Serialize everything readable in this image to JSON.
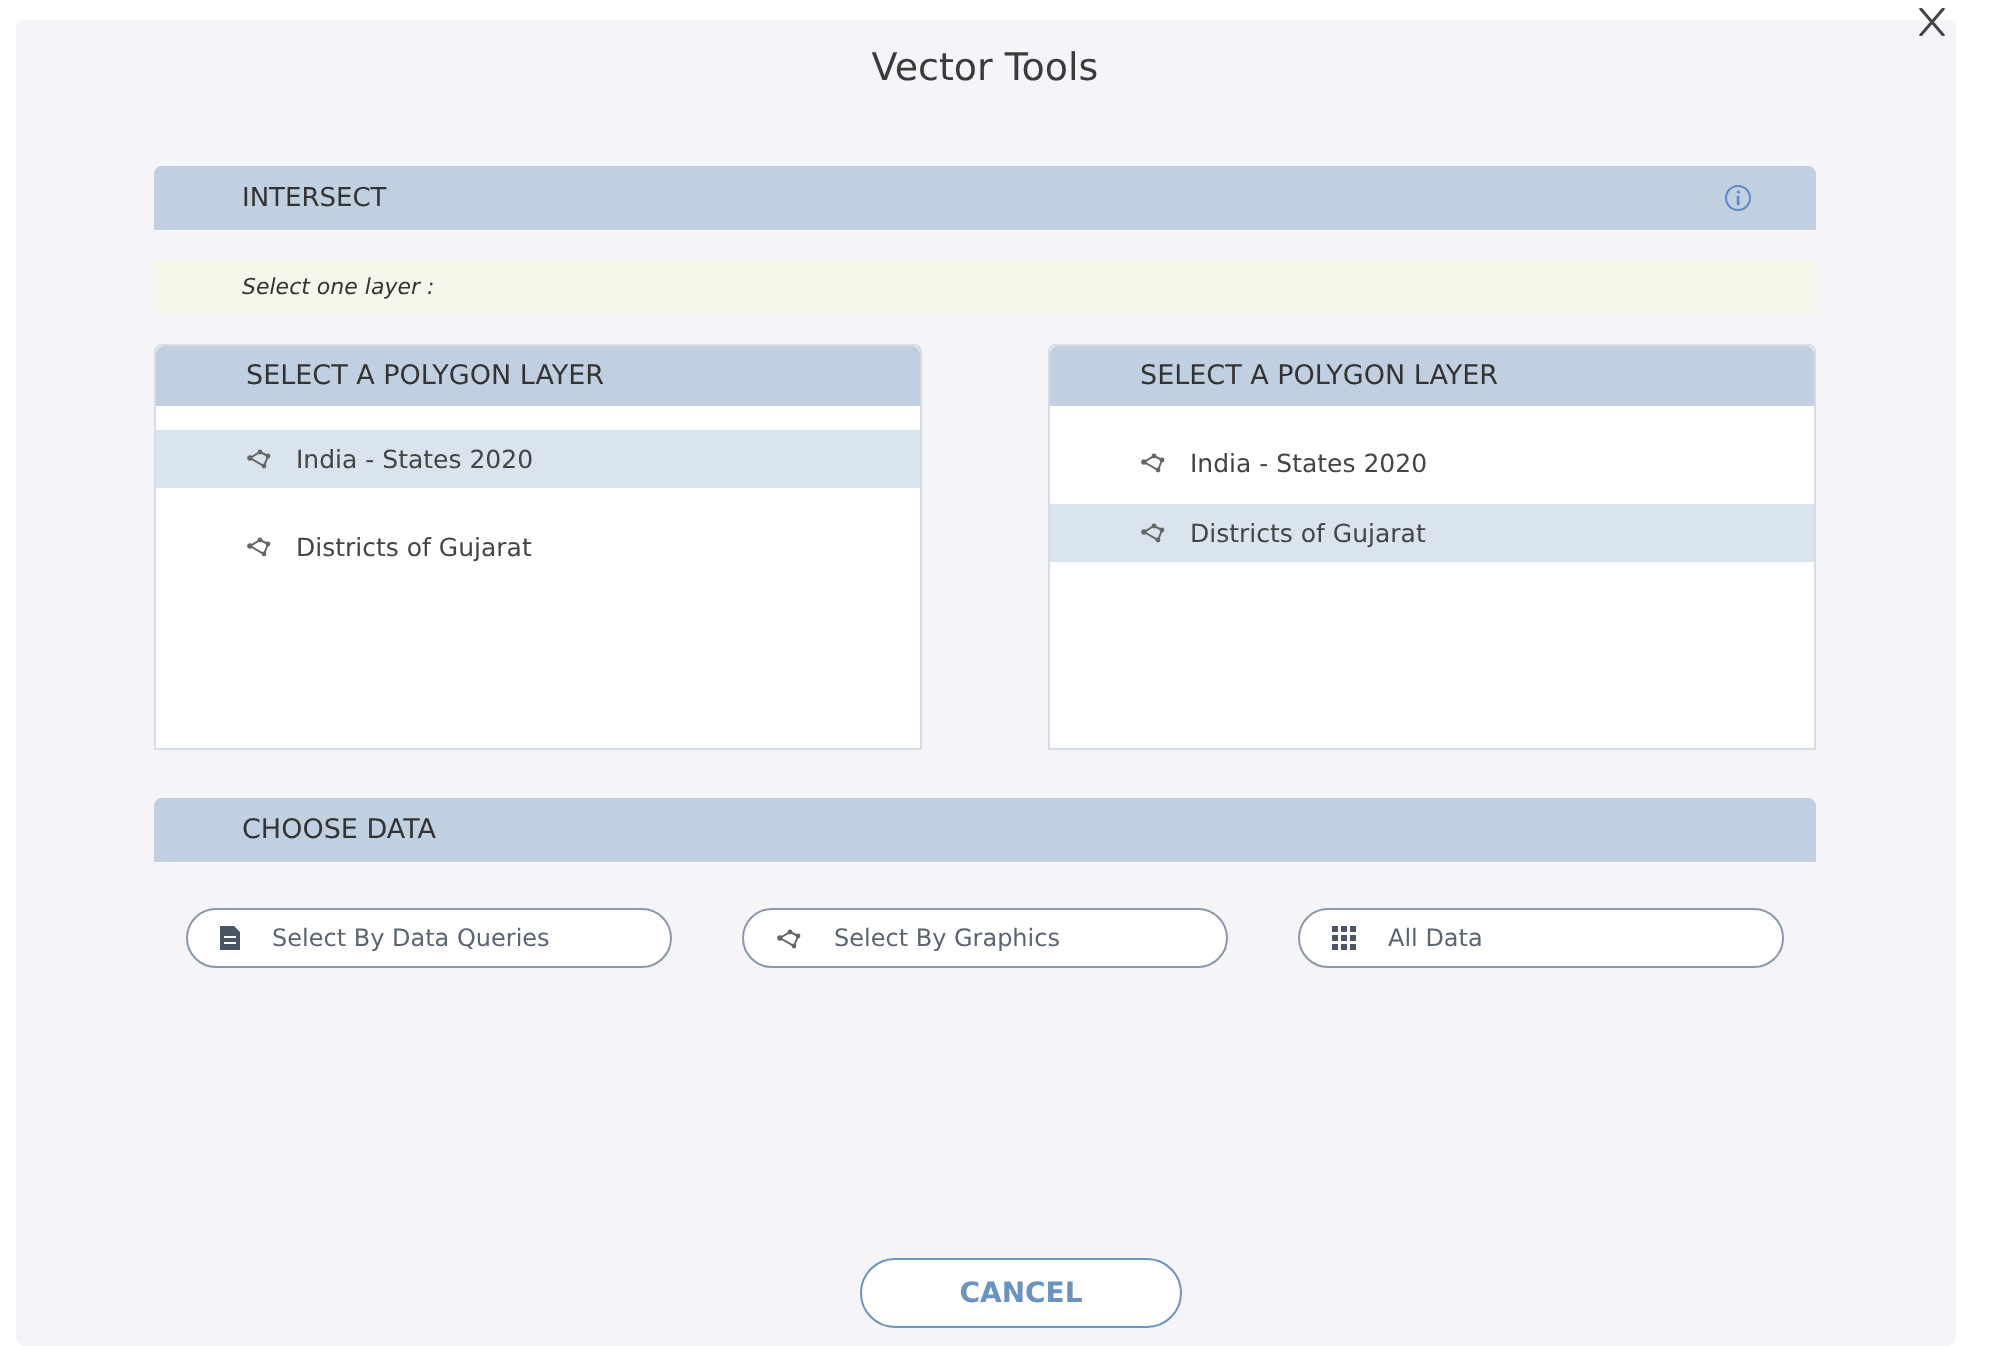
{
  "dialog": {
    "title": "Vector Tools"
  },
  "tool_header": {
    "label": "INTERSECT"
  },
  "hint": "Select one layer :",
  "layer_panels": [
    {
      "title": "SELECT A POLYGON LAYER",
      "items": [
        {
          "label": "India - States 2020",
          "selected": true
        },
        {
          "label": "Districts of Gujarat",
          "selected": false
        }
      ]
    },
    {
      "title": "SELECT A POLYGON LAYER",
      "items": [
        {
          "label": "India - States 2020",
          "selected": false
        },
        {
          "label": "Districts of Gujarat",
          "selected": true
        }
      ]
    }
  ],
  "data_header": {
    "label": "CHOOSE DATA"
  },
  "data_options": [
    {
      "label": "Select By Data Queries",
      "kind": "document"
    },
    {
      "label": "Select By Graphics",
      "kind": "graphics"
    },
    {
      "label": "All Data",
      "kind": "grid"
    }
  ],
  "buttons": [
    {
      "label": "CANCEL"
    }
  ]
}
